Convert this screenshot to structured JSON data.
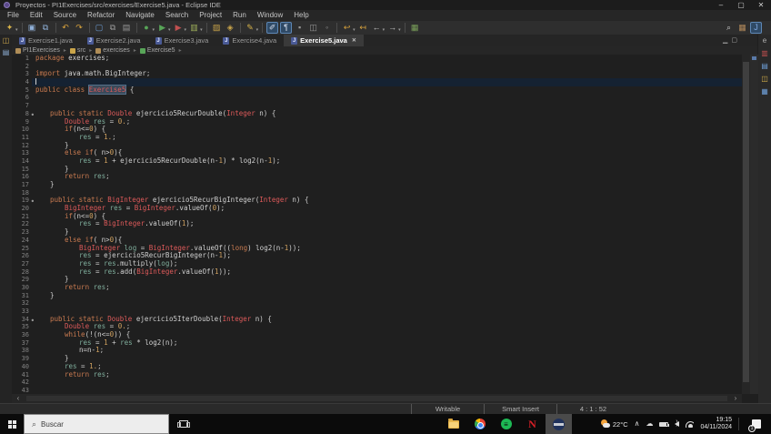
{
  "window": {
    "title": "Proyectos - PI1Exercises/src/exercises/Exercise5.java - Eclipse IDE",
    "controls": {
      "minimize": "–",
      "maximize": "▢",
      "close": "✕"
    }
  },
  "menu": {
    "items": [
      "File",
      "Edit",
      "Source",
      "Refactor",
      "Navigate",
      "Search",
      "Project",
      "Run",
      "Window",
      "Help"
    ]
  },
  "toolbar": {
    "groups": [
      [
        {
          "n": "new-wizard",
          "g": "✦",
          "c": "#d9b44a",
          "dd": true
        }
      ],
      [
        {
          "n": "save",
          "g": "▣",
          "c": "#8fb0d8"
        },
        {
          "n": "save-all",
          "g": "⧉",
          "c": "#8fb0d8"
        }
      ],
      [
        {
          "n": "undo",
          "g": "↶",
          "c": "#d9a33c"
        },
        {
          "n": "redo",
          "g": "↷",
          "c": "#d9a33c"
        }
      ],
      [
        {
          "n": "open-resource",
          "g": "▢",
          "c": "#6f9fd8"
        },
        {
          "n": "copy",
          "g": "⧉",
          "c": "#9a9a9a"
        },
        {
          "n": "paste",
          "g": "▤",
          "c": "#9a9a9a"
        }
      ],
      [
        {
          "n": "debug",
          "g": "●",
          "c": "#58a558",
          "dd": true
        },
        {
          "n": "run",
          "g": "▶",
          "c": "#58a558",
          "dd": true
        },
        {
          "n": "profile",
          "g": "▶",
          "c": "#c05050",
          "dd": true
        },
        {
          "n": "coverage",
          "g": "▥",
          "c": "#9fb05a",
          "dd": true
        }
      ],
      [
        {
          "n": "new-java-project",
          "g": "▨",
          "c": "#caa54a"
        },
        {
          "n": "new-class",
          "g": "◈",
          "c": "#caa54a"
        }
      ],
      [
        {
          "n": "external-tools",
          "g": "✎",
          "c": "#d9b44a",
          "dd": true
        }
      ],
      [
        {
          "n": "mark-occurrences",
          "g": "✐",
          "c": "#cfd8e8",
          "active": true
        },
        {
          "n": "show-whitespace",
          "g": "¶",
          "c": "#cfd8e8",
          "active": true
        },
        {
          "n": "annotations",
          "g": "▪",
          "c": "#9a9a9a"
        },
        {
          "n": "open-task",
          "g": "◫",
          "c": "#9a9a9a"
        },
        {
          "n": "pin-editor",
          "g": "◦",
          "c": "#9a9a9a"
        }
      ],
      [
        {
          "n": "last-edit-location",
          "g": "↩",
          "c": "#d9a33c",
          "dd": true
        },
        {
          "n": "previous-edit",
          "g": "↤",
          "c": "#d9a33c"
        },
        {
          "n": "back",
          "g": "←",
          "c": "#c8c8c8",
          "dd": true
        },
        {
          "n": "forward",
          "g": "→",
          "c": "#c8c8c8",
          "dd": true
        }
      ],
      [
        {
          "n": "open-element",
          "g": "▦",
          "c": "#7aa05a"
        }
      ]
    ],
    "right": [
      {
        "n": "search",
        "g": "⌕",
        "c": "#c8c8c8"
      },
      {
        "n": "perspective-javaee",
        "g": "▦",
        "c": "#b0885a"
      },
      {
        "n": "perspective-java",
        "g": "J",
        "c": "#7fa7e0",
        "active": true
      }
    ]
  },
  "tabs": [
    {
      "label": "Exercise1.java",
      "active": false
    },
    {
      "label": "Exercise2.java",
      "active": false
    },
    {
      "label": "Exercise3.java",
      "active": false
    },
    {
      "label": "Exercise4.java",
      "active": false
    },
    {
      "label": "Exercise5.java",
      "active": true,
      "close": "✕"
    }
  ],
  "view_buttons": {
    "minimize": "▁",
    "maximize": "▢"
  },
  "breadcrumb": {
    "separator": "▸",
    "items": [
      {
        "label": "PI1Exercises",
        "icon": "project-icon",
        "c": "#b08d57"
      },
      {
        "label": "src",
        "icon": "source-folder-icon",
        "c": "#caa54a"
      },
      {
        "label": "exercises",
        "icon": "package-icon",
        "c": "#b08d57"
      },
      {
        "label": "Exercise5",
        "icon": "class-icon",
        "c": "#58a558"
      }
    ]
  },
  "left_strip": [
    {
      "n": "restore-package-explorer",
      "g": "◫",
      "c": "#caa54a"
    },
    {
      "n": "restore-view",
      "g": "▤",
      "c": "#8fb0d8"
    }
  ],
  "right_strip": [
    {
      "n": "minimized-view-1",
      "g": "e",
      "c": "#b0b0b0"
    },
    {
      "n": "minimized-view-2",
      "g": "▥",
      "c": "#c05050"
    },
    {
      "n": "minimized-view-3",
      "g": "▤",
      "c": "#6f9fd8"
    },
    {
      "n": "minimized-view-4",
      "g": "◫",
      "c": "#d9b44a"
    },
    {
      "n": "minimized-view-5",
      "g": "▦",
      "c": "#6f9fd8"
    }
  ],
  "editor": {
    "hscroll_left": "‹",
    "hscroll_right": "›",
    "lines": [
      {
        "n": 1,
        "i": 0,
        "t": [
          [
            "k",
            "package"
          ],
          [
            "m",
            " exercises"
          ],
          [
            "p",
            ";"
          ]
        ]
      },
      {
        "n": 2,
        "i": 0,
        "t": []
      },
      {
        "n": 3,
        "i": 0,
        "t": [
          [
            "k",
            "import"
          ],
          [
            "m",
            " java.math.BigInteger"
          ],
          [
            "p",
            ";"
          ]
        ]
      },
      {
        "n": 4,
        "i": 0,
        "cur": true,
        "t": []
      },
      {
        "n": 5,
        "i": 0,
        "t": [
          [
            "k",
            "public class "
          ],
          [
            "c",
            "Exercise5"
          ],
          [
            "m",
            " {"
          ]
        ]
      },
      {
        "n": 6,
        "i": 0,
        "t": []
      },
      {
        "n": 7,
        "i": 0,
        "t": []
      },
      {
        "n": 8,
        "i": 1,
        "f": true,
        "t": [
          [
            "k",
            "public static "
          ],
          [
            "t",
            "Double"
          ],
          [
            "m",
            " ejercicio5RecurDouble("
          ],
          [
            "t",
            "Integer"
          ],
          [
            "m",
            " n) {"
          ]
        ]
      },
      {
        "n": 9,
        "i": 2,
        "t": [
          [
            "t",
            "Double"
          ],
          [
            "m",
            " "
          ],
          [
            "v",
            "res"
          ],
          [
            "m",
            " = "
          ],
          [
            "n",
            "0."
          ],
          [
            "p",
            ";"
          ]
        ]
      },
      {
        "n": 10,
        "i": 2,
        "t": [
          [
            "k",
            "if"
          ],
          [
            "m",
            "(n<="
          ],
          [
            "n",
            "0"
          ],
          [
            "m",
            ") {"
          ]
        ]
      },
      {
        "n": 11,
        "i": 3,
        "t": [
          [
            "v",
            "res"
          ],
          [
            "m",
            " = "
          ],
          [
            "n",
            "1."
          ],
          [
            "p",
            ";"
          ]
        ]
      },
      {
        "n": 12,
        "i": 2,
        "t": [
          [
            "m",
            "}"
          ]
        ]
      },
      {
        "n": 13,
        "i": 2,
        "t": [
          [
            "k",
            "else if"
          ],
          [
            "m",
            "( n>"
          ],
          [
            "n",
            "0"
          ],
          [
            "m",
            "){"
          ]
        ]
      },
      {
        "n": 14,
        "i": 3,
        "t": [
          [
            "v",
            "res"
          ],
          [
            "m",
            " = "
          ],
          [
            "n",
            "1"
          ],
          [
            "m",
            " + ejercicio5RecurDouble(n-"
          ],
          [
            "n",
            "1"
          ],
          [
            "m",
            ") * log2(n-"
          ],
          [
            "n",
            "1"
          ],
          [
            "m",
            ");"
          ]
        ]
      },
      {
        "n": 15,
        "i": 2,
        "t": [
          [
            "m",
            "}"
          ]
        ]
      },
      {
        "n": 16,
        "i": 2,
        "t": [
          [
            "k",
            "return"
          ],
          [
            "m",
            " "
          ],
          [
            "v",
            "res"
          ],
          [
            "p",
            ";"
          ]
        ]
      },
      {
        "n": 17,
        "i": 1,
        "t": [
          [
            "m",
            "}"
          ]
        ]
      },
      {
        "n": 18,
        "i": 0,
        "t": []
      },
      {
        "n": 19,
        "i": 1,
        "f": true,
        "t": [
          [
            "k",
            "public static "
          ],
          [
            "t",
            "BigInteger"
          ],
          [
            "m",
            " ejercicio5RecurBigInteger("
          ],
          [
            "t",
            "Integer"
          ],
          [
            "m",
            " n) {"
          ]
        ]
      },
      {
        "n": 20,
        "i": 2,
        "t": [
          [
            "t",
            "BigInteger"
          ],
          [
            "m",
            " "
          ],
          [
            "v",
            "res"
          ],
          [
            "m",
            " = "
          ],
          [
            "t",
            "BigInteger"
          ],
          [
            "m",
            ".valueOf("
          ],
          [
            "n",
            "0"
          ],
          [
            "m",
            ");"
          ]
        ]
      },
      {
        "n": 21,
        "i": 2,
        "t": [
          [
            "k",
            "if"
          ],
          [
            "m",
            "(n<="
          ],
          [
            "n",
            "0"
          ],
          [
            "m",
            ") {"
          ]
        ]
      },
      {
        "n": 22,
        "i": 3,
        "t": [
          [
            "v",
            "res"
          ],
          [
            "m",
            " = "
          ],
          [
            "t",
            "BigInteger"
          ],
          [
            "m",
            ".valueOf("
          ],
          [
            "n",
            "1"
          ],
          [
            "m",
            ");"
          ]
        ]
      },
      {
        "n": 23,
        "i": 2,
        "t": [
          [
            "m",
            "}"
          ]
        ]
      },
      {
        "n": 24,
        "i": 2,
        "t": [
          [
            "k",
            "else if"
          ],
          [
            "m",
            "( n>"
          ],
          [
            "n",
            "0"
          ],
          [
            "m",
            "){"
          ]
        ]
      },
      {
        "n": 25,
        "i": 3,
        "t": [
          [
            "t",
            "BigInteger"
          ],
          [
            "m",
            " "
          ],
          [
            "v",
            "log"
          ],
          [
            "m",
            " = "
          ],
          [
            "t",
            "BigInteger"
          ],
          [
            "m",
            ".valueOf(("
          ],
          [
            "k",
            "long"
          ],
          [
            "m",
            ") log2(n-"
          ],
          [
            "n",
            "1"
          ],
          [
            "m",
            "));"
          ]
        ]
      },
      {
        "n": 26,
        "i": 3,
        "t": [
          [
            "v",
            "res"
          ],
          [
            "m",
            " = ejercicio5RecurBigInteger(n-"
          ],
          [
            "n",
            "1"
          ],
          [
            "m",
            ");"
          ]
        ]
      },
      {
        "n": 27,
        "i": 3,
        "t": [
          [
            "v",
            "res"
          ],
          [
            "m",
            " = "
          ],
          [
            "v",
            "res"
          ],
          [
            "m",
            ".multiply("
          ],
          [
            "v",
            "log"
          ],
          [
            "m",
            ");"
          ]
        ]
      },
      {
        "n": 28,
        "i": 3,
        "t": [
          [
            "v",
            "res"
          ],
          [
            "m",
            " = "
          ],
          [
            "v",
            "res"
          ],
          [
            "m",
            ".add("
          ],
          [
            "t",
            "BigInteger"
          ],
          [
            "m",
            ".valueOf("
          ],
          [
            "n",
            "1"
          ],
          [
            "m",
            "));"
          ]
        ]
      },
      {
        "n": 29,
        "i": 2,
        "t": [
          [
            "m",
            "}"
          ]
        ]
      },
      {
        "n": 30,
        "i": 2,
        "t": [
          [
            "k",
            "return"
          ],
          [
            "m",
            " "
          ],
          [
            "v",
            "res"
          ],
          [
            "p",
            ";"
          ]
        ]
      },
      {
        "n": 31,
        "i": 1,
        "t": [
          [
            "m",
            "}"
          ]
        ]
      },
      {
        "n": 32,
        "i": 0,
        "t": []
      },
      {
        "n": 33,
        "i": 0,
        "t": []
      },
      {
        "n": 34,
        "i": 1,
        "f": true,
        "t": [
          [
            "k",
            "public static "
          ],
          [
            "t",
            "Double"
          ],
          [
            "m",
            " ejercicio5IterDouble("
          ],
          [
            "t",
            "Integer"
          ],
          [
            "m",
            " n) {"
          ]
        ]
      },
      {
        "n": 35,
        "i": 2,
        "t": [
          [
            "t",
            "Double"
          ],
          [
            "m",
            " "
          ],
          [
            "v",
            "res"
          ],
          [
            "m",
            " = "
          ],
          [
            "n",
            "0."
          ],
          [
            "p",
            ";"
          ]
        ]
      },
      {
        "n": 36,
        "i": 2,
        "t": [
          [
            "k",
            "while"
          ],
          [
            "m",
            "(!(n<="
          ],
          [
            "n",
            "0"
          ],
          [
            "m",
            ")) {"
          ]
        ]
      },
      {
        "n": 37,
        "i": 3,
        "t": [
          [
            "v",
            "res"
          ],
          [
            "m",
            " = "
          ],
          [
            "n",
            "1"
          ],
          [
            "m",
            " + "
          ],
          [
            "v",
            "res"
          ],
          [
            "m",
            " * log2(n);"
          ]
        ]
      },
      {
        "n": 38,
        "i": 3,
        "t": [
          [
            "m",
            "n=n-"
          ],
          [
            "n",
            "1"
          ],
          [
            "p",
            ";"
          ]
        ]
      },
      {
        "n": 39,
        "i": 2,
        "t": [
          [
            "m",
            "}"
          ]
        ]
      },
      {
        "n": 40,
        "i": 2,
        "t": [
          [
            "v",
            "res"
          ],
          [
            "m",
            " = "
          ],
          [
            "n",
            "1."
          ],
          [
            "p",
            ";"
          ]
        ]
      },
      {
        "n": 41,
        "i": 2,
        "t": [
          [
            "k",
            "return"
          ],
          [
            "m",
            " "
          ],
          [
            "v",
            "res"
          ],
          [
            "p",
            ";"
          ]
        ]
      },
      {
        "n": 42,
        "i": 0,
        "t": []
      },
      {
        "n": 43,
        "i": 0,
        "t": []
      }
    ]
  },
  "statusbar": {
    "writable": "Writable",
    "insert_mode": "Smart Insert",
    "position": "4 : 1 : 52"
  },
  "taskbar": {
    "search_placeholder": "Buscar",
    "apps": [
      {
        "name": "file-explorer"
      },
      {
        "name": "chrome"
      },
      {
        "name": "spotify"
      },
      {
        "name": "netflix"
      },
      {
        "name": "eclipse",
        "active": true
      }
    ],
    "tray": {
      "temperature": "22°C",
      "time": "19:15",
      "date": "04/11/2024",
      "notification_count": "1"
    }
  }
}
